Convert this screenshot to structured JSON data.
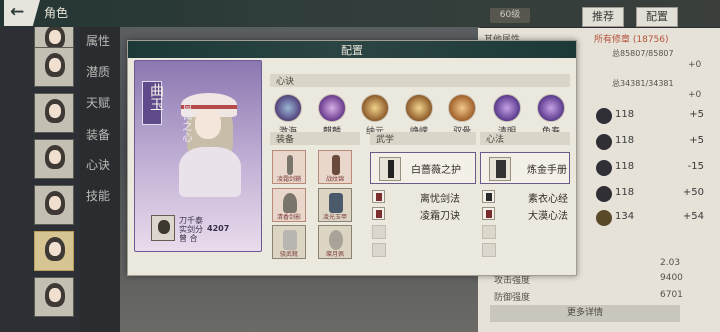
{
  "top_bar": {
    "back_icon": "←",
    "title": "角色"
  },
  "right_top": {
    "level": "60级",
    "recommend_btn": "推荐",
    "config_btn": "配置",
    "partial_title": "其他属性"
  },
  "bubble_text": "•••",
  "left_menu": [
    "属性",
    "潜质",
    "天赋",
    "装备",
    "心诀",
    "技能"
  ],
  "right_stats": [
    {
      "prefix": "所有修章 (18756)",
      "val": "总85807/85807",
      "plus": "+0"
    },
    {
      "prefix": "",
      "val": "总34381/34381",
      "plus": "+0"
    }
  ],
  "right_rows": [
    {
      "val": "118",
      "plus": "+5"
    },
    {
      "val": "118",
      "plus": "+5"
    },
    {
      "val": "118",
      "plus": "-15"
    },
    {
      "val": "118",
      "plus": "+50"
    },
    {
      "val": "134",
      "plus": "+54"
    }
  ],
  "bottom_stats": [
    {
      "label": "",
      "value": "2.03"
    },
    {
      "label": "攻击强度",
      "value": "9400"
    },
    {
      "label": "防御强度",
      "value": "6701"
    }
  ],
  "more_btn": "更多详情",
  "config": {
    "title": "配置",
    "card": {
      "name": "曲玉",
      "subtitle": "蔷薇之心",
      "info_lines": [
        "刀千泰",
        "实剑分",
        "4207",
        "曾 合"
      ]
    },
    "xinjue_label": "心诀",
    "skills": [
      "激海",
      "麒麟",
      "纳元",
      "峥嵘",
      "驭骨",
      "清明",
      "龟寿"
    ],
    "equip_label": "装备",
    "equips": [
      {
        "label": "凌霜剑鞘"
      },
      {
        "label": "战纹锦"
      },
      {
        "label": "清香剑影"
      },
      {
        "label": "凌光玉甲"
      },
      {
        "label": "骁武靴"
      },
      {
        "label": "璨月佩"
      }
    ],
    "wuxue_label": "武学",
    "wuxue_main": "白蔷薇之护",
    "wuxue_list": [
      "离忧剑法",
      "凌霜刀诀"
    ],
    "xinfa_label": "心法",
    "xinfa_main": "炼金手册",
    "xinfa_list": [
      "素衣心经",
      "大漠心法"
    ]
  }
}
